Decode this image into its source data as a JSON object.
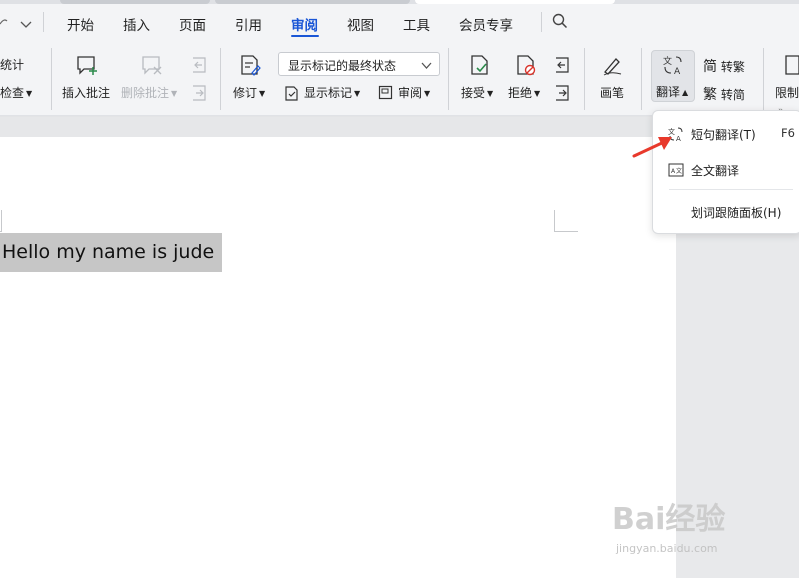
{
  "menubar": {
    "tabs": [
      {
        "label": "开始"
      },
      {
        "label": "插入"
      },
      {
        "label": "页面"
      },
      {
        "label": "引用"
      },
      {
        "label": "审阅"
      },
      {
        "label": "视图"
      },
      {
        "label": "工具"
      },
      {
        "label": "会员专享"
      }
    ],
    "active_tab": "审阅"
  },
  "ribbon": {
    "stats_label": "统计",
    "check_label": "检查",
    "insert_comment": "插入批注",
    "delete_comment": "删除批注",
    "revise": "修订",
    "markup_state": "显示标记的最终状态",
    "show_markup": "显示标记",
    "review": "审阅",
    "accept": "接受",
    "reject": "拒绝",
    "pen": "画笔",
    "translate": "翻译",
    "to_traditional": "转繁",
    "to_simplified": "转简",
    "restrict": "限制"
  },
  "popup": {
    "items": [
      {
        "label": "短句翻译(T)",
        "shortcut": "F6"
      },
      {
        "label": "全文翻译",
        "shortcut": ""
      },
      {
        "label": "划词跟随面板(H)",
        "shortcut": ""
      }
    ]
  },
  "document": {
    "text": "Hello my name is jude"
  },
  "watermark": {
    "main": "Bai经验",
    "sub": "jingyan.baidu.com"
  },
  "colors": {
    "accent": "#1a56d6",
    "arrow": "#e8392b",
    "selection": "#c6c6c6"
  }
}
